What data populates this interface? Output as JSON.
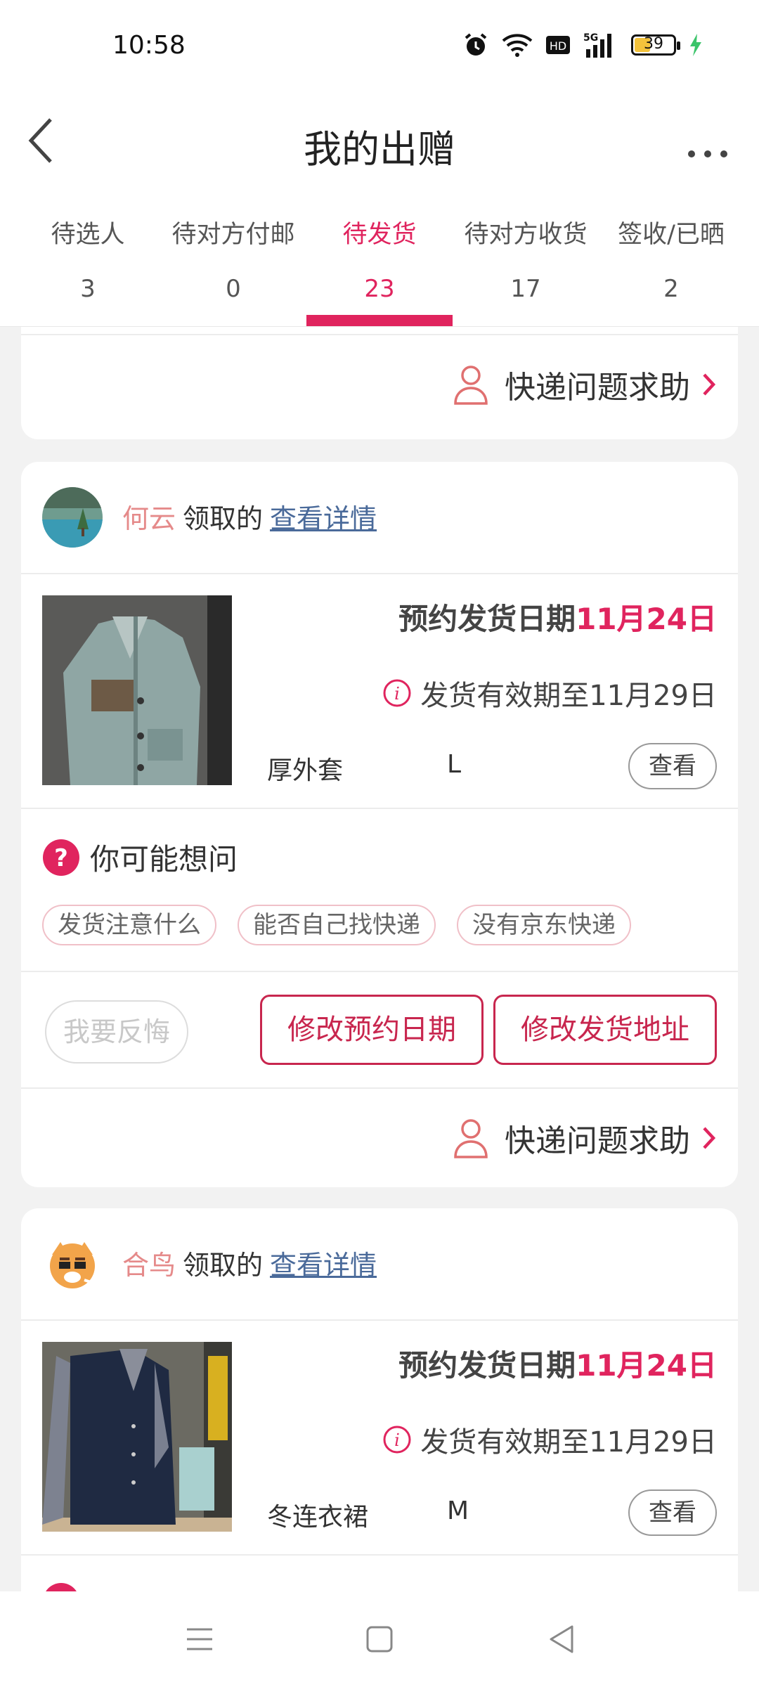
{
  "status": {
    "time": "10:58",
    "battery": "39"
  },
  "header": {
    "title": "我的出赠"
  },
  "tabs": [
    {
      "label": "待选人",
      "count": "3"
    },
    {
      "label": "待对方付邮",
      "count": "0"
    },
    {
      "label": "待发货",
      "count": "23"
    },
    {
      "label": "待对方收货",
      "count": "17"
    },
    {
      "label": "签收/已晒",
      "count": "2"
    }
  ],
  "help_label": "快递问题求助",
  "cards": [
    {
      "giver": "何云",
      "claim_text": "领取的",
      "detail_link": "查看详情",
      "ship_label": "预约发货日期",
      "ship_date": "11月24日",
      "valid_text": "发货有效期至11月29日",
      "item_name": "厚外套",
      "item_size": "L",
      "view_label": "查看",
      "faq_title": "你可能想问",
      "faq_chips": [
        "发货注意什么",
        "能否自己找快递",
        "没有京东快递"
      ],
      "regret_label": "我要反悔",
      "change_date_label": "修改预约日期",
      "change_address_label": "修改发货地址"
    },
    {
      "giver": "合鸟",
      "claim_text": "领取的",
      "detail_link": "查看详情",
      "ship_label": "预约发货日期",
      "ship_date": "11月24日",
      "valid_text": "发货有效期至11月29日",
      "item_name": "冬连衣裙",
      "item_size": "M",
      "view_label": "查看"
    }
  ],
  "colors": {
    "accent": "#e0245e",
    "link": "#4a6a9a",
    "name": "#e58a8a"
  }
}
